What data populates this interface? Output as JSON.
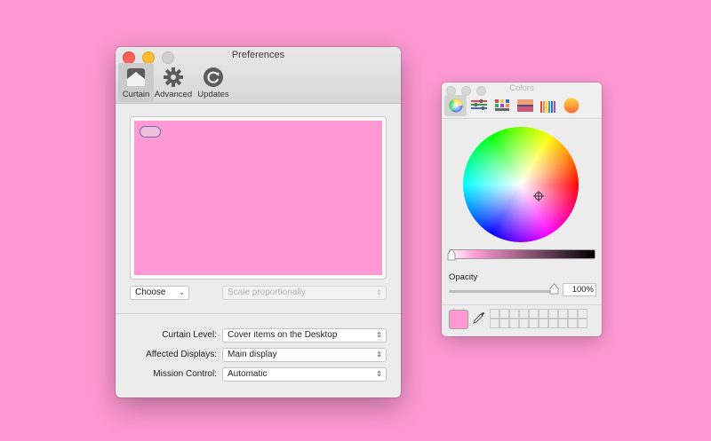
{
  "preferences": {
    "title": "Preferences",
    "toolbar": {
      "curtain": "Curtain",
      "advanced": "Advanced",
      "updates": "Updates"
    },
    "choose": "Choose",
    "scale": "Scale proportionally",
    "fields": [
      {
        "label": "Curtain Level:",
        "value": "Cover items on the Desktop"
      },
      {
        "label": "Affected Displays:",
        "value": "Main display"
      },
      {
        "label": "Mission Control:",
        "value": "Automatic"
      }
    ]
  },
  "colors": {
    "title": "Colors",
    "opacity_label": "Opacity",
    "opacity_value": "100%",
    "opacity_level": 1.0,
    "selected_color": "#ff99d3",
    "modes": [
      "color-wheel-icon",
      "color-sliders-icon",
      "color-palettes-icon",
      "image-palettes-icon",
      "pencils-icon",
      "spectrum-icon"
    ]
  },
  "theme": {
    "desktop": "#ff99d3",
    "close": "#fe5f57",
    "minimize": "#febc2e"
  }
}
